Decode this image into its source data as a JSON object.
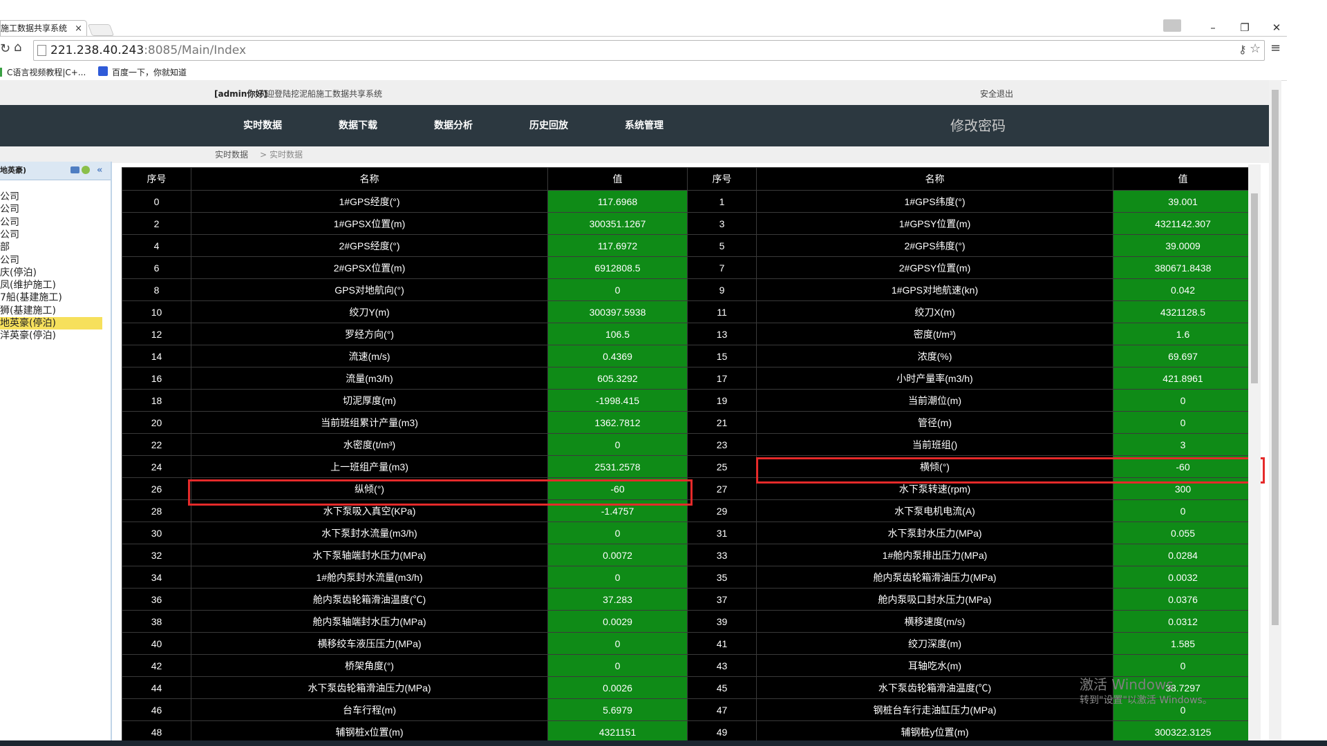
{
  "browser": {
    "tab_title": "施工数据共享系统",
    "tab_close": "×",
    "url_host": "221.238.40.243",
    "url_rest": ":8085/Main/Index",
    "bookmarks": [
      "C语言视频教程|C+...",
      "百度一下，你就知道"
    ],
    "win_min": "–",
    "win_restore": "❐",
    "win_close": "✕"
  },
  "header": {
    "user": "[admin你好]",
    "welcome": " 欢迎登陆挖泥船施工数据共享系统",
    "logout": "安全退出"
  },
  "nav": {
    "items": [
      "实时数据",
      "数据下载",
      "数据分析",
      "历史回放",
      "系统管理"
    ],
    "change_password": "修改密码"
  },
  "breadcrumb": {
    "first": "实时数据",
    "sep": ">",
    "second": "实时数据"
  },
  "sidebar": {
    "title": "地英豪)",
    "items": [
      "公司",
      "公司",
      "公司",
      "公司",
      "部",
      "公司",
      "庆(停泊)",
      "凤(维护施工)",
      "7船(基建施工)",
      "狮(基建施工)",
      "地英豪(停泊)",
      "洋英豪(停泊)"
    ],
    "selected_index": 10
  },
  "table": {
    "headers": [
      "序号",
      "名称",
      "值",
      "序号",
      "名称",
      "值"
    ],
    "rows": [
      [
        "0",
        "1#GPS经度(°)",
        "117.6968",
        "1",
        "1#GPS纬度(°)",
        "39.001"
      ],
      [
        "2",
        "1#GPSX位置(m)",
        "300351.1267",
        "3",
        "1#GPSY位置(m)",
        "4321142.307"
      ],
      [
        "4",
        "2#GPS经度(°)",
        "117.6972",
        "5",
        "2#GPS纬度(°)",
        "39.0009"
      ],
      [
        "6",
        "2#GPSX位置(m)",
        "6912808.5",
        "7",
        "2#GPSY位置(m)",
        "380671.8438"
      ],
      [
        "8",
        "GPS对地航向(°)",
        "0",
        "9",
        "1#GPS对地航速(kn)",
        "0.042"
      ],
      [
        "10",
        "绞刀Y(m)",
        "300397.5938",
        "11",
        "绞刀X(m)",
        "4321128.5"
      ],
      [
        "12",
        "罗经方向(°)",
        "106.5",
        "13",
        "密度(t/m³)",
        "1.6"
      ],
      [
        "14",
        "流速(m/s)",
        "0.4369",
        "15",
        "浓度(%)",
        "69.697"
      ],
      [
        "16",
        "流量(m3/h)",
        "605.3292",
        "17",
        "小时产量率(m3/h)",
        "421.8961"
      ],
      [
        "18",
        "切泥厚度(m)",
        "-1998.415",
        "19",
        "当前潮位(m)",
        "0"
      ],
      [
        "20",
        "当前班组累计产量(m3)",
        "1362.7812",
        "21",
        "管径(m)",
        "0"
      ],
      [
        "22",
        "水密度(t/m³)",
        "0",
        "23",
        "当前班组()",
        "3"
      ],
      [
        "24",
        "上一班组产量(m3)",
        "2531.2578",
        "25",
        "横倾(°)",
        "-60"
      ],
      [
        "26",
        "纵倾(°)",
        "-60",
        "27",
        "水下泵转速(rpm)",
        "300"
      ],
      [
        "28",
        "水下泵吸入真空(KPa)",
        "-1.4757",
        "29",
        "水下泵电机电流(A)",
        "0"
      ],
      [
        "30",
        "水下泵封水流量(m3/h)",
        "0",
        "31",
        "水下泵封水压力(MPa)",
        "0.055"
      ],
      [
        "32",
        "水下泵轴端封水压力(MPa)",
        "0.0072",
        "33",
        "1#舱内泵排出压力(MPa)",
        "0.0284"
      ],
      [
        "34",
        "1#舱内泵封水流量(m3/h)",
        "0",
        "35",
        "舱内泵齿轮箱滑油压力(MPa)",
        "0.0032"
      ],
      [
        "36",
        "舱内泵齿轮箱滑油温度(℃)",
        "37.283",
        "37",
        "舱内泵吸口封水压力(MPa)",
        "0.0376"
      ],
      [
        "38",
        "舱内泵轴端封水压力(MPa)",
        "0.0029",
        "39",
        "横移速度(m/s)",
        "0.0312"
      ],
      [
        "40",
        "横移绞车液压压力(MPa)",
        "0",
        "41",
        "绞刀深度(m)",
        "1.585"
      ],
      [
        "42",
        "桥架角度(°)",
        "0",
        "43",
        "耳轴吃水(m)",
        "0"
      ],
      [
        "44",
        "水下泵齿轮箱滑油压力(MPa)",
        "0.0026",
        "45",
        "水下泵齿轮箱滑油温度(℃)",
        "38.7297"
      ],
      [
        "46",
        "台车行程(m)",
        "5.6979",
        "47",
        "钢桩台车行走油缸压力(MPa)",
        "0"
      ],
      [
        "48",
        "辅钢桩x位置(m)",
        "4321151",
        "49",
        "辅钢桩y位置(m)",
        "300322.3125"
      ]
    ]
  },
  "watermark": {
    "line1": "激活 Windows",
    "line2": "转到\"设置\"以激活 Windows。"
  },
  "colors": {
    "value_bg": "#0f8b17",
    "nav_bg": "#2c3840",
    "highlight": "#e52a2a"
  }
}
